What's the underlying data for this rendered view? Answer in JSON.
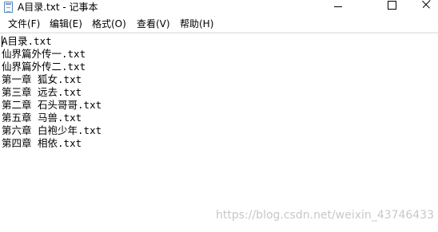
{
  "window": {
    "title": "A目录.txt - 记事本",
    "icon": "notepad-icon"
  },
  "menu": {
    "items": [
      {
        "label": "文件(F)"
      },
      {
        "label": "编辑(E)"
      },
      {
        "label": "格式(O)"
      },
      {
        "label": "查看(V)"
      },
      {
        "label": "帮助(H)"
      }
    ]
  },
  "document": {
    "lines": [
      "A目录.txt",
      "仙界篇外传一.txt",
      "仙界篇外传二.txt",
      "第一章 狐女.txt",
      "第三章 远去.txt",
      "第二章 石头哥哥.txt",
      "第五章 马兽.txt",
      "第六章 白袍少年.txt",
      "第四章 相依.txt"
    ]
  },
  "watermark": {
    "text": "https://blog.csdn.net/weixin_43746433"
  }
}
